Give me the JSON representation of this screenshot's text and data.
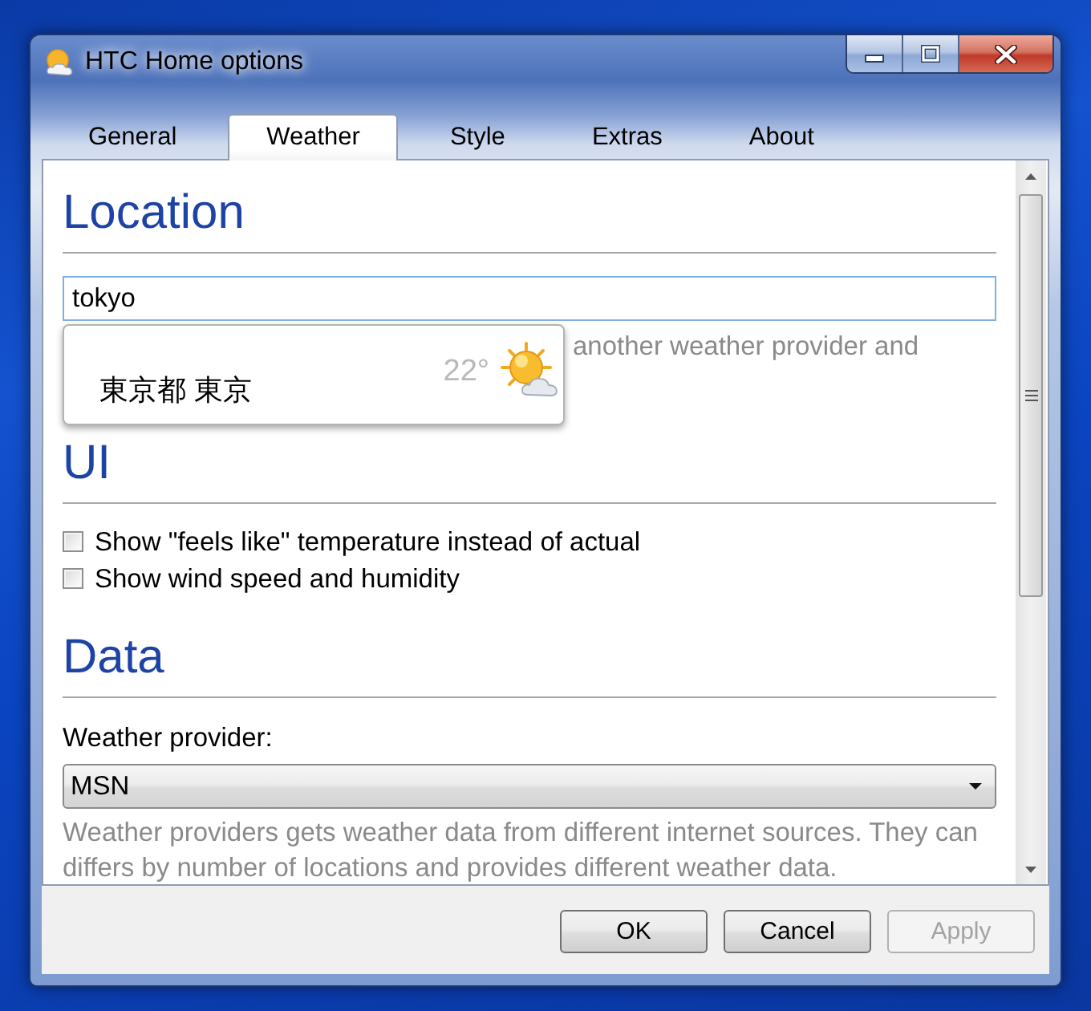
{
  "window": {
    "title": "HTC Home options"
  },
  "tabs": [
    {
      "label": "General",
      "selected": false
    },
    {
      "label": "Weather",
      "selected": true
    },
    {
      "label": "Style",
      "selected": false
    },
    {
      "label": "Extras",
      "selected": false
    },
    {
      "label": "About",
      "selected": false
    }
  ],
  "location": {
    "heading": "Location",
    "field": {
      "value": "tokyo"
    },
    "hint": "another weather provider and",
    "suggestions": [
      {
        "name": "東京都 東京",
        "temperature": "22°"
      }
    ]
  },
  "ui": {
    "heading": "UI",
    "options": [
      {
        "label": "Show \"feels like\" temperature instead of actual",
        "checked": false
      },
      {
        "label": "Show wind speed and humidity",
        "checked": false
      }
    ]
  },
  "data": {
    "heading": "Data",
    "provider": {
      "label": "Weather provider:",
      "value": "MSN"
    },
    "hint": "Weather providers gets weather data from different internet sources. They can differs by number of locations and provides different weather data."
  },
  "buttons": [
    {
      "label": "OK",
      "disabled": false
    },
    {
      "label": "Cancel",
      "disabled": false
    },
    {
      "label": "Apply",
      "disabled": true
    }
  ]
}
